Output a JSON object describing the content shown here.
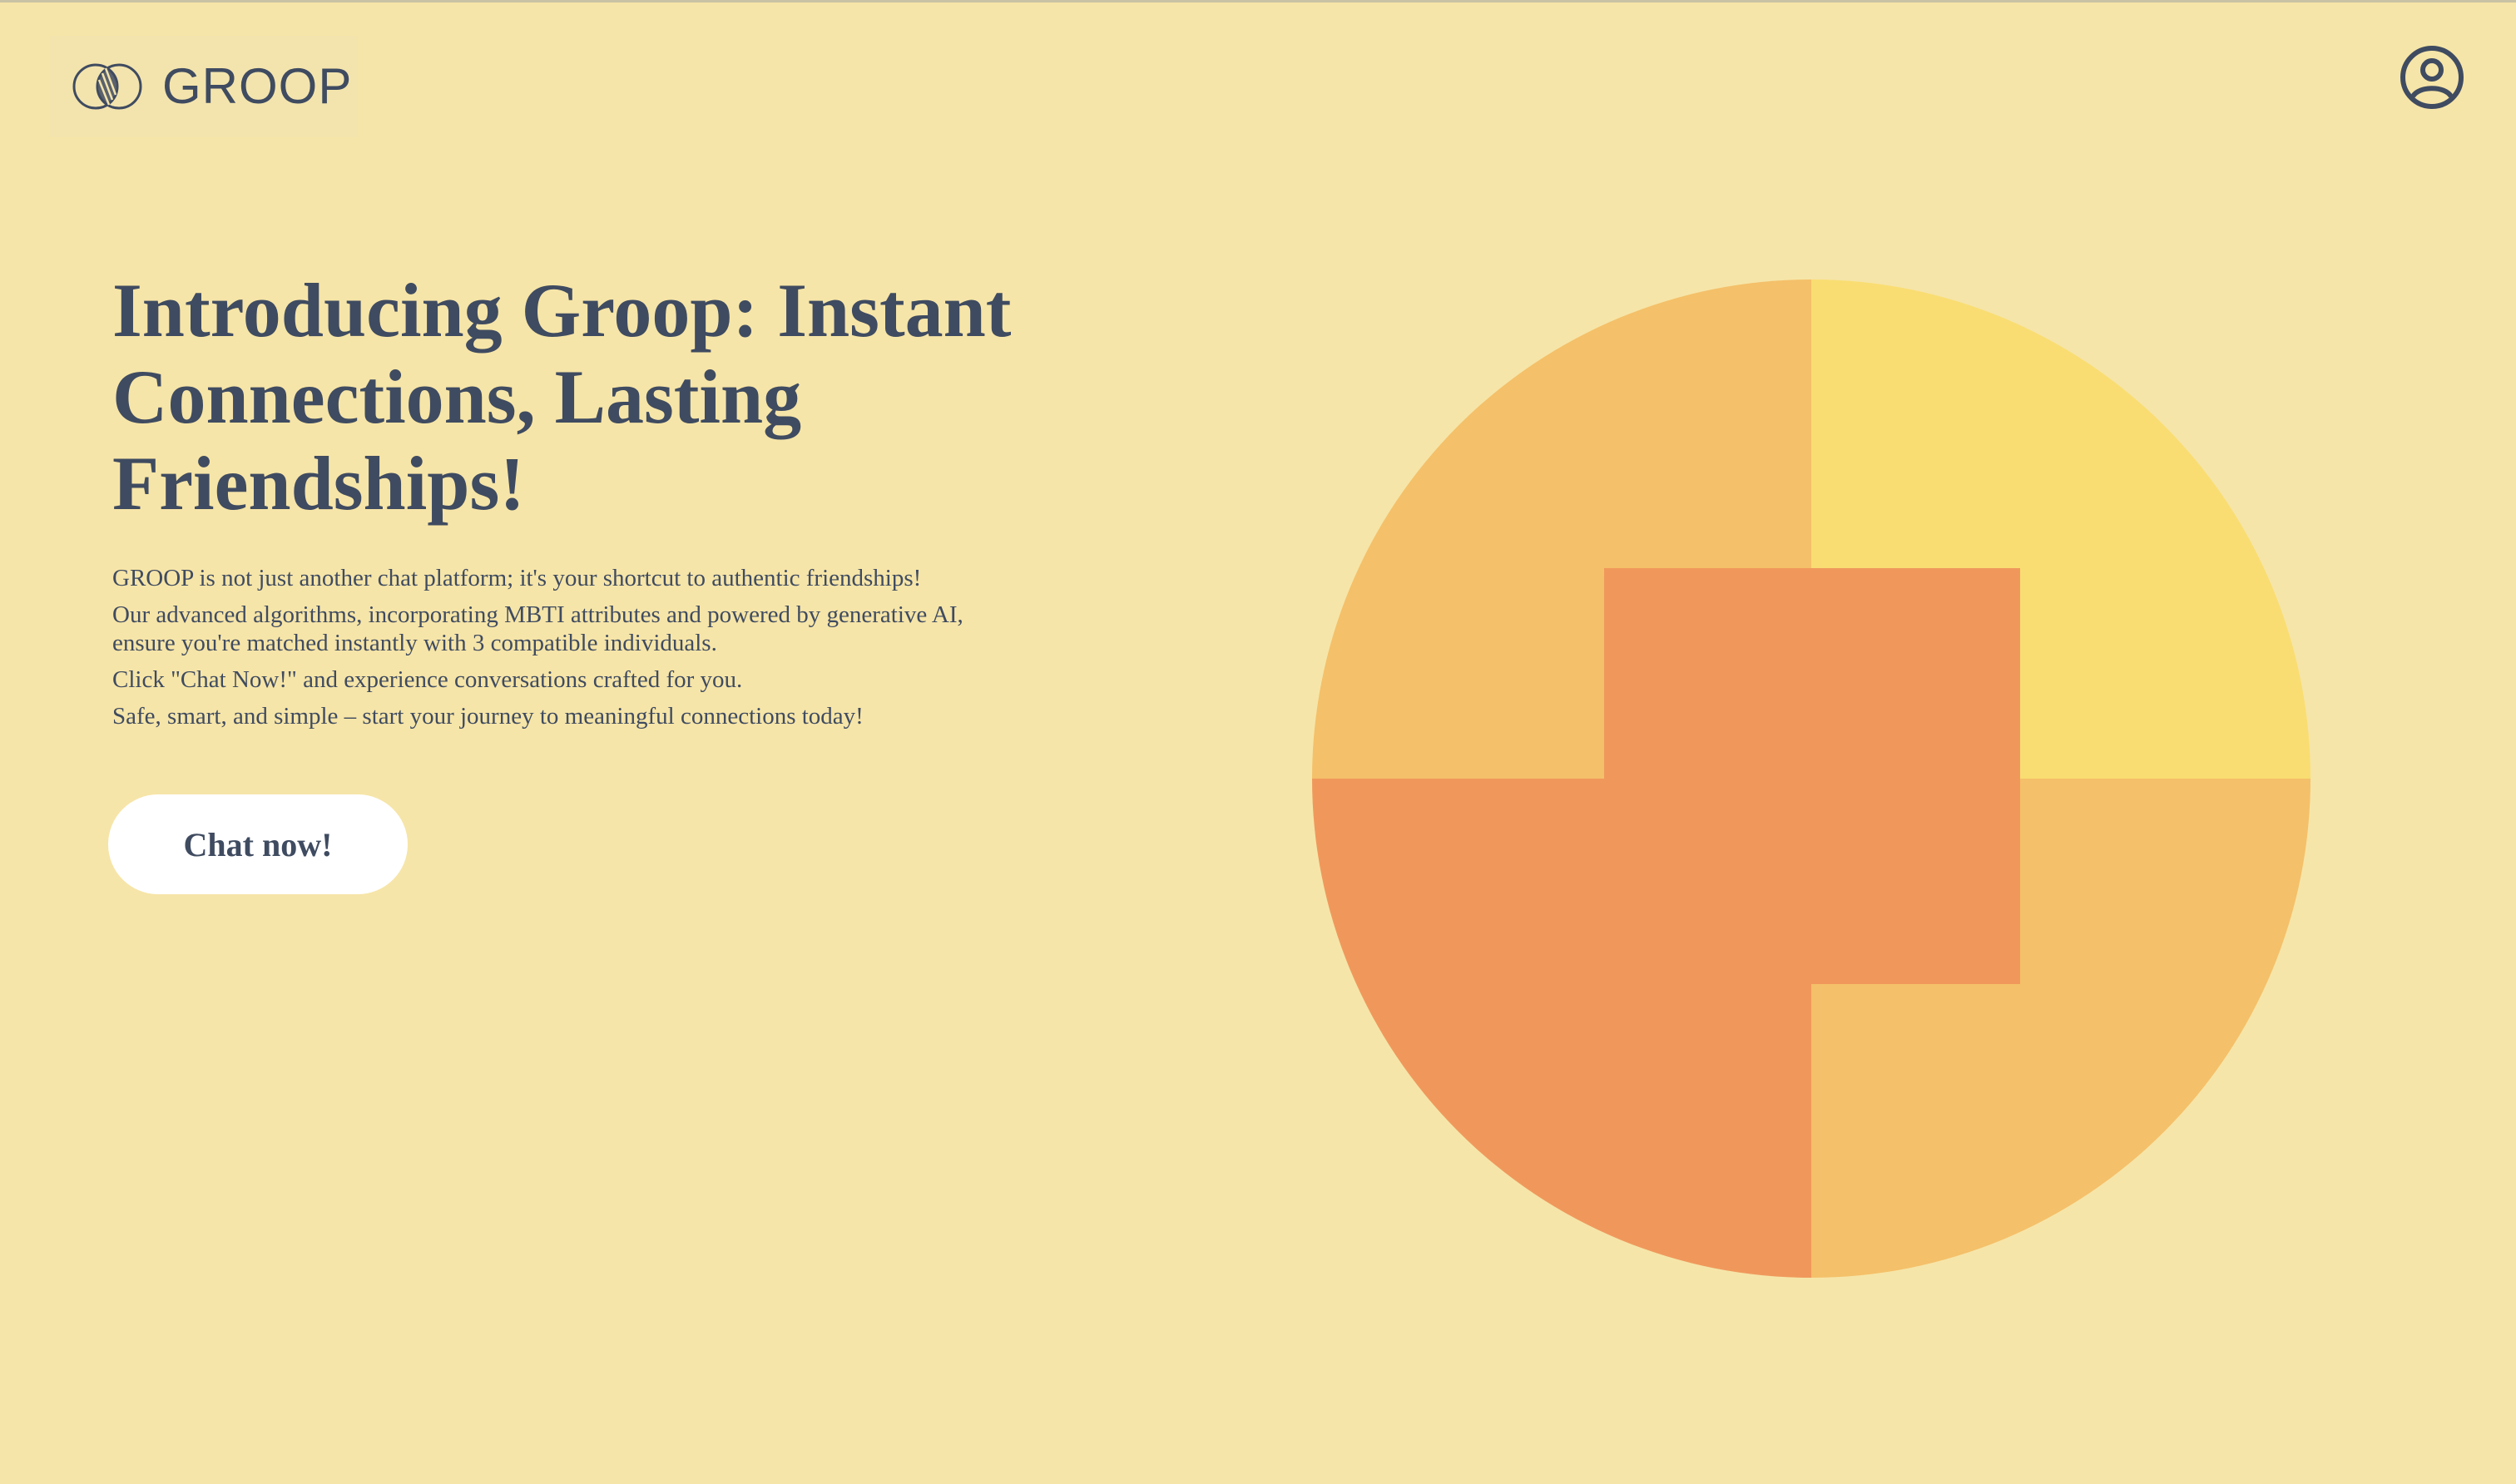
{
  "brand": {
    "name": "GROOP"
  },
  "hero": {
    "headline": "Introducing Groop: Instant Connections, Lasting Friendships!",
    "paragraphs": [
      "GROOP is not just another chat platform; it's your shortcut to authentic friendships!",
      "Our advanced algorithms, incorporating MBTI attributes and powered by generative AI, ensure you're matched instantly with 3 compatible individuals.",
      "Click \"Chat Now!\" and experience conversations crafted for you.",
      "Safe, smart, and simple – start your journey to meaningful connections today!"
    ],
    "cta_label": "Chat now!"
  },
  "icons": {
    "logo": "interlocking-circles-leaf-icon",
    "profile": "user-circle-icon"
  },
  "colors": {
    "background": "#f6e5a8",
    "text": "#3f4b60",
    "button_bg": "#ffffff",
    "art_light_orange": "#f4c069",
    "art_yellow": "#f9dd72",
    "art_dark_orange": "#f0985c"
  }
}
